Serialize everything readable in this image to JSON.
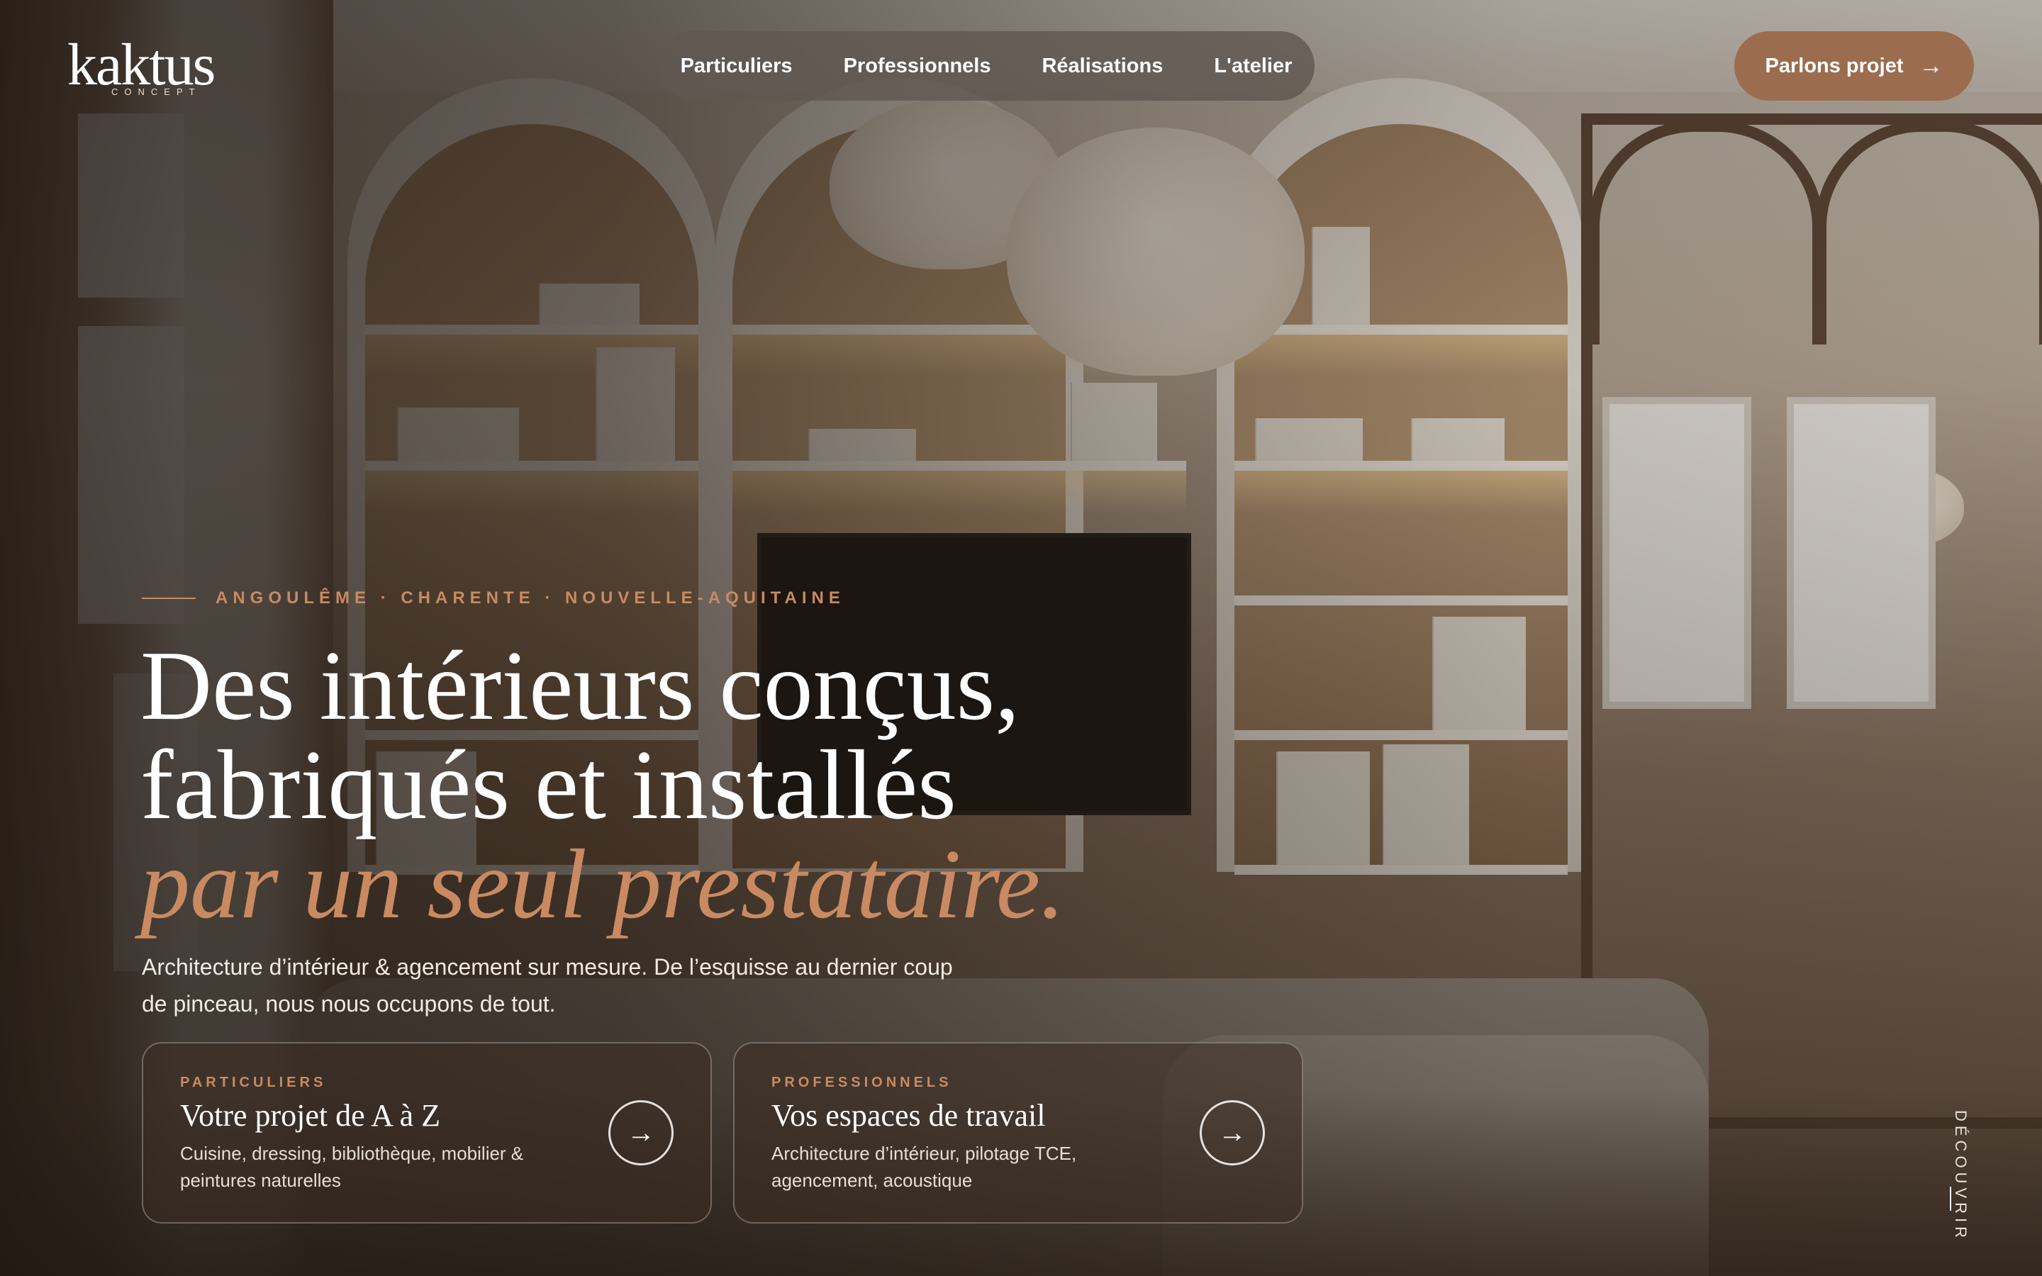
{
  "brand": {
    "name": "kaktus",
    "tagline": "CONCEPT"
  },
  "nav": {
    "items": [
      "Particuliers",
      "Professionnels",
      "Réalisations",
      "L'atelier"
    ]
  },
  "cta": {
    "label": "Parlons projet",
    "arrow": "→"
  },
  "hero": {
    "eyebrow": "ANGOULÊME · CHARENTE · NOUVELLE-AQUITAINE",
    "headline_line1": "Des intérieurs conçus,",
    "headline_line2": "fabriqués et installés",
    "headline_accent": "par un seul prestataire.",
    "lead": "Architecture d’intérieur & agencement sur mesure. De l’esquisse au dernier coup de pinceau, nous nous occupons de tout."
  },
  "cards": [
    {
      "kicker": "PARTICULIERS",
      "title": "Votre projet de A à Z",
      "desc": "Cuisine, dressing, bibliothèque, mobilier & peintures naturelles",
      "arrow": "→"
    },
    {
      "kicker": "PROFESSIONNELS",
      "title": "Vos espaces de travail",
      "desc": "Architecture d’intérieur, pilotage TCE, agencement, acoustique",
      "arrow": "→"
    }
  ],
  "scroll_hint": "DÉCOUVRIR",
  "colors": {
    "accent": "#c98a62",
    "cta_bg": "#9b6d4e",
    "nav_bg": "#605850"
  }
}
